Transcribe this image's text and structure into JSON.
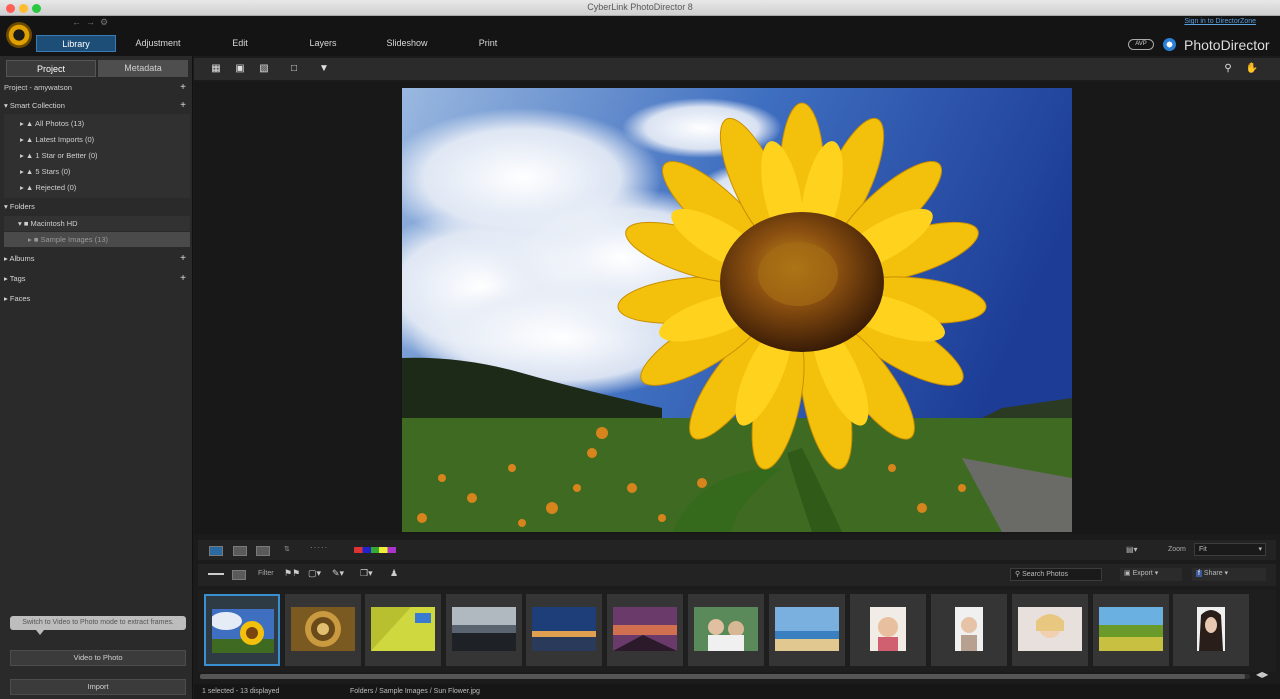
{
  "window": {
    "title": "CyberLink PhotoDirector 8"
  },
  "header": {
    "signin": "Sign in to DirectorZone",
    "avp_badge": "AVP",
    "brand": "PhotoDirector",
    "tabs": [
      "Library",
      "Adjustment",
      "Edit",
      "Layers",
      "Slideshow",
      "Print"
    ]
  },
  "sidebar": {
    "tabs": {
      "project": "Project",
      "metadata": "Metadata"
    },
    "project_label": "Project - amywatson",
    "smart_collection": {
      "label": "Smart Collection",
      "items": [
        "All Photos (13)",
        "Latest Imports (0)",
        "1 Star or Better (0)",
        "5 Stars (0)",
        "Rejected (0)"
      ]
    },
    "folders": {
      "label": "Folders",
      "items": [
        "Macintosh HD",
        "Sample Images (13)"
      ]
    },
    "albums": "Albums",
    "tags": "Tags",
    "faces": "Faces",
    "tooltip": "Switch to Video to Photo mode to extract frames.",
    "buttons": {
      "video_to_photo": "Video to Photo",
      "import": "Import"
    }
  },
  "filmstrip": {
    "filter_label": "Filter",
    "zoom_label": "Zoom",
    "zoom_value": "Fit",
    "search_placeholder": "Search Photos",
    "export_label": "Export",
    "share_label": "Share",
    "thumbnail_count": 13,
    "selected_index": 0
  },
  "status": {
    "selection": "1 selected - 13 displayed",
    "path": "Folders / Sample Images / Sun Flower.jpg"
  },
  "colors": {
    "accent": "#1d4e78",
    "selection": "#3a8fd0",
    "background": "#1b1b1b"
  }
}
